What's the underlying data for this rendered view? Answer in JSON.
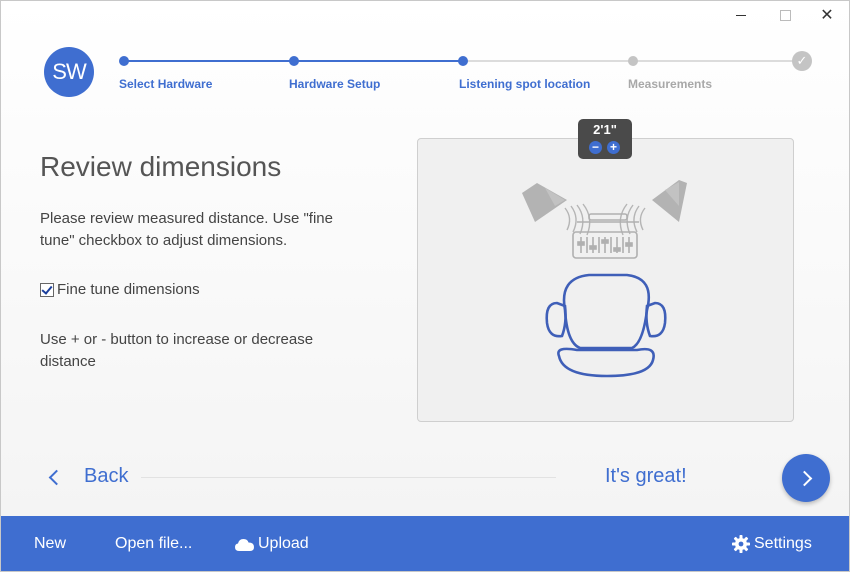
{
  "window": {
    "controls": {
      "minimize": "",
      "maximize": "",
      "close": "✕"
    }
  },
  "logo": {
    "text": "SW"
  },
  "stepper": {
    "steps": [
      {
        "label": "Select Hardware",
        "state": "done"
      },
      {
        "label": "Hardware Setup",
        "state": "done"
      },
      {
        "label": "Listening spot location",
        "state": "done"
      },
      {
        "label": "Measurements",
        "state": "todo"
      }
    ],
    "final_icon": "check-icon",
    "final_glyph": "✓"
  },
  "main": {
    "title": "Review dimensions",
    "description": "Please review measured distance. Use \"fine tune\" checkbox to adjust dimensions.",
    "fine_tune": {
      "label": "Fine tune dimensions",
      "checked": true
    },
    "hint": "Use + or - button to increase or decrease distance"
  },
  "diagram": {
    "distance": "2'1\"",
    "minus": "−",
    "plus": "+"
  },
  "nav": {
    "back_label": "Back",
    "confirm_label": "It's great!"
  },
  "footer": {
    "new_label": "New",
    "open_label": "Open file...",
    "upload_label": "Upload",
    "settings_label": "Settings"
  },
  "colors": {
    "accent": "#3f6ed0",
    "inactive": "#c4c4c4",
    "badge": "#4a4a4a"
  }
}
